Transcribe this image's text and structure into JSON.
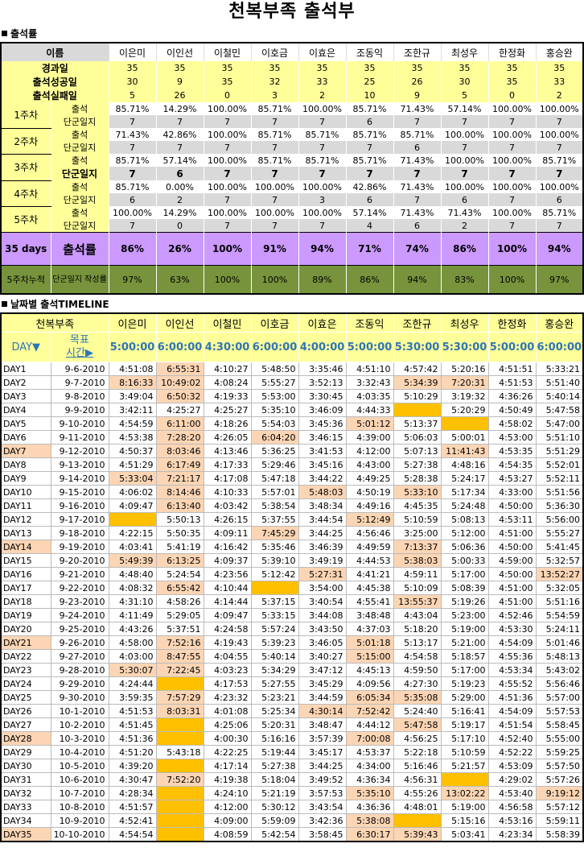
{
  "title": "천복부족 출석부",
  "section1": {
    "label": "출석률"
  },
  "section2": {
    "label": "날짜별 출석TIMELINE"
  },
  "names": [
    "이은미",
    "이인선",
    "이철민",
    "이호금",
    "이효은",
    "조동익",
    "조한규",
    "최성우",
    "한정화",
    "홍승완"
  ],
  "header_label": "이름",
  "summary": [
    {
      "label": "경과일",
      "values": [
        "35",
        "35",
        "35",
        "35",
        "35",
        "35",
        "35",
        "35",
        "35",
        "35"
      ]
    },
    {
      "label": "출석성공일",
      "values": [
        "30",
        "9",
        "35",
        "32",
        "33",
        "25",
        "26",
        "30",
        "35",
        "33"
      ]
    },
    {
      "label": "출석실패일",
      "values": [
        "5",
        "26",
        "0",
        "3",
        "2",
        "10",
        "9",
        "5",
        "0",
        "2"
      ]
    }
  ],
  "weeks": [
    {
      "label": "1주차",
      "att_label": "출석",
      "log_label": "단군일지",
      "att": [
        "85.71%",
        "14.29%",
        "100.00%",
        "85.71%",
        "100.00%",
        "85.71%",
        "71.43%",
        "57.14%",
        "100.00%",
        "100.00%"
      ],
      "log": [
        "7",
        "7",
        "7",
        "7",
        "7",
        "6",
        "7",
        "7",
        "7",
        "7"
      ]
    },
    {
      "label": "2주차",
      "att_label": "출석",
      "log_label": "단군일지",
      "att": [
        "71.43%",
        "42.86%",
        "100.00%",
        "85.71%",
        "85.71%",
        "85.71%",
        "85.71%",
        "100.00%",
        "100.00%",
        "100.00%"
      ],
      "log": [
        "7",
        "7",
        "7",
        "7",
        "7",
        "7",
        "6",
        "7",
        "7",
        "7"
      ]
    },
    {
      "label": "3주차",
      "att_label": "출석",
      "log_label": "단군일지",
      "att": [
        "85.71%",
        "57.14%",
        "100.00%",
        "85.71%",
        "85.71%",
        "85.71%",
        "71.43%",
        "100.00%",
        "100.00%",
        "85.71%"
      ],
      "log": [
        "7",
        "6",
        "7",
        "7",
        "7",
        "7",
        "7",
        "7",
        "7",
        "7"
      ]
    },
    {
      "label": "4주차",
      "att_label": "출석",
      "log_label": "단군일지",
      "att": [
        "85.71%",
        "0.00%",
        "100.00%",
        "100.00%",
        "100.00%",
        "42.86%",
        "71.43%",
        "100.00%",
        "100.00%",
        "100.00%"
      ],
      "log": [
        "6",
        "2",
        "7",
        "7",
        "3",
        "6",
        "7",
        "6",
        "7",
        "6"
      ]
    },
    {
      "label": "5주차",
      "att_label": "출석",
      "log_label": "단군일지",
      "att": [
        "100.00%",
        "14.29%",
        "100.00%",
        "100.00%",
        "100.00%",
        "57.14%",
        "71.43%",
        "71.43%",
        "100.00%",
        "85.71%"
      ],
      "log": [
        "7",
        "0",
        "7",
        "7",
        "7",
        "4",
        "6",
        "2",
        "7",
        "7"
      ]
    }
  ],
  "rate": {
    "label1": "35 days",
    "label2": "출석률",
    "values": [
      "86%",
      "26%",
      "100%",
      "91%",
      "94%",
      "71%",
      "74%",
      "86%",
      "100%",
      "94%"
    ]
  },
  "cumulative": {
    "label1": "5주차누적",
    "label2": "단군일지 작성률",
    "values": [
      "97%",
      "63%",
      "100%",
      "100%",
      "89%",
      "86%",
      "94%",
      "83%",
      "100%",
      "97%"
    ]
  },
  "timeline": {
    "corner": "천복부족",
    "day_header": "DAY▼",
    "goal_label_1": "목표",
    "goal_label_2": "시간▶",
    "goals": [
      "5:00:00",
      "6:00:00",
      "4:30:00",
      "6:00:00",
      "4:00:00",
      "5:00:00",
      "5:30:00",
      "5:30:00",
      "5:00:00",
      "6:00:00"
    ],
    "rows": [
      {
        "day": "DAY1",
        "date": "9-6-2010",
        "t": [
          "4:51:08",
          "6:55:31",
          "4:10:27",
          "5:48:50",
          "3:35:46",
          "4:51:10",
          "4:57:42",
          "5:20:16",
          "4:51:51",
          "5:33:21"
        ]
      },
      {
        "day": "DAY2",
        "date": "9-7-2010",
        "t": [
          "8:16:33",
          "10:49:02",
          "4:08:24",
          "5:55:27",
          "3:52:13",
          "3:32:43",
          "5:34:39",
          "7:20:31",
          "4:51:53",
          "5:51:40"
        ]
      },
      {
        "day": "DAY3",
        "date": "9-8-2010",
        "t": [
          "3:49:04",
          "6:50:32",
          "4:19:33",
          "5:53:00",
          "3:30:45",
          "4:03:35",
          "5:10:29",
          "3:19:32",
          "4:36:26",
          "5:40:14"
        ]
      },
      {
        "day": "DAY4",
        "date": "9-9-2010",
        "t": [
          "3:42:11",
          "4:25:27",
          "4:25:27",
          "5:35:10",
          "3:46:09",
          "4:44:33",
          "",
          "5:20:29",
          "4:50:49",
          "5:47:58"
        ]
      },
      {
        "day": "DAY5",
        "date": "9-10-2010",
        "t": [
          "4:54:59",
          "6:11:00",
          "4:18:26",
          "5:54:03",
          "3:45:36",
          "5:01:12",
          "5:13:37",
          "",
          "4:58:02",
          "5:47:00"
        ]
      },
      {
        "day": "DAY6",
        "date": "9-11-2010",
        "t": [
          "4:53:38",
          "7:28:20",
          "4:26:05",
          "6:04:20",
          "3:46:15",
          "4:39:00",
          "5:06:03",
          "5:00:01",
          "4:53:00",
          "5:51:10"
        ]
      },
      {
        "day": "DAY7",
        "date": "9-12-2010",
        "t": [
          "4:50:37",
          "8:03:46",
          "4:13:46",
          "5:36:25",
          "3:41:53",
          "4:12:00",
          "5:07:13",
          "11:41:43",
          "4:53:35",
          "5:51:29"
        ]
      },
      {
        "day": "DAY8",
        "date": "9-13-2010",
        "t": [
          "4:51:29",
          "6:17:49",
          "4:17:33",
          "5:29:46",
          "3:45:16",
          "4:43:00",
          "5:27:38",
          "4:48:16",
          "4:54:35",
          "5:52:01"
        ]
      },
      {
        "day": "DAY9",
        "date": "9-14-2010",
        "t": [
          "5:33:04",
          "7:21:17",
          "4:17:08",
          "5:47:18",
          "3:44:22",
          "4:49:25",
          "5:28:38",
          "5:24:17",
          "4:53:27",
          "5:52:11"
        ]
      },
      {
        "day": "DAY10",
        "date": "9-15-2010",
        "t": [
          "4:06:02",
          "8:14:46",
          "4:10:33",
          "5:57:01",
          "5:48:03",
          "4:50:19",
          "5:33:10",
          "5:17:34",
          "4:33:00",
          "5:51:56"
        ]
      },
      {
        "day": "DAY11",
        "date": "9-16-2010",
        "t": [
          "4:09:47",
          "6:13:40",
          "4:03:42",
          "5:38:54",
          "3:48:34",
          "4:49:16",
          "4:45:35",
          "5:24:48",
          "4:50:00",
          "5:36:30"
        ]
      },
      {
        "day": "DAY12",
        "date": "9-17-2010",
        "t": [
          "",
          "5:50:13",
          "4:26:15",
          "5:37:55",
          "3:44:54",
          "5:12:49",
          "5:10:59",
          "5:08:13",
          "4:53:11",
          "5:56:00"
        ]
      },
      {
        "day": "DAY13",
        "date": "9-18-2010",
        "t": [
          "4:22:15",
          "5:50:35",
          "4:09:11",
          "7:45:29",
          "3:44:25",
          "4:56:46",
          "3:25:00",
          "5:12:00",
          "4:51:00",
          "5:55:27"
        ]
      },
      {
        "day": "DAY14",
        "date": "9-19-2010",
        "t": [
          "4:03:41",
          "5:41:19",
          "4:16:42",
          "5:35:46",
          "3:46:39",
          "4:49:59",
          "7:13:37",
          "5:06:36",
          "4:50:00",
          "5:41:45"
        ]
      },
      {
        "day": "DAY15",
        "date": "9-20-2010",
        "t": [
          "5:49:39",
          "6:13:25",
          "4:09:37",
          "5:39:10",
          "3:49:19",
          "4:44:53",
          "5:38:03",
          "5:00:33",
          "4:59:00",
          "5:32:57"
        ]
      },
      {
        "day": "DAY16",
        "date": "9-21-2010",
        "t": [
          "4:48:40",
          "5:24:54",
          "4:23:56",
          "5:12:42",
          "5:27:31",
          "4:41:21",
          "4:59:11",
          "5:17:00",
          "4:50:00",
          "13:52:27"
        ]
      },
      {
        "day": "DAY17",
        "date": "9-22-2010",
        "t": [
          "4:08:32",
          "6:55:42",
          "4:10:44",
          "",
          "3:54:00",
          "4:45:38",
          "5:10:09",
          "5:08:39",
          "4:51:00",
          "5:32:05"
        ]
      },
      {
        "day": "DAY18",
        "date": "9-23-2010",
        "t": [
          "4:31:10",
          "4:58:26",
          "4:14:44",
          "5:37:15",
          "3:40:54",
          "4:55:41",
          "13:55:37",
          "5:19:26",
          "4:51:00",
          "5:51:16"
        ]
      },
      {
        "day": "DAY19",
        "date": "9-24-2010",
        "t": [
          "4:11:49",
          "5:29:05",
          "4:09:47",
          "5:33:15",
          "3:44:08",
          "3:48:48",
          "4:43:04",
          "5:23:00",
          "4:52:46",
          "5:54:59"
        ]
      },
      {
        "day": "DAY20",
        "date": "9-25-2010",
        "t": [
          "4:43:26",
          "5:37:51",
          "4:24:58",
          "5:57:24",
          "3:43:50",
          "4:37:03",
          "5:18:20",
          "5:19:00",
          "4:53:30",
          "5:24:11"
        ]
      },
      {
        "day": "DAY21",
        "date": "9-26-2010",
        "t": [
          "4:58:00",
          "7:52:16",
          "4:19:43",
          "5:39:23",
          "3:46:05",
          "5:01:18",
          "5:13:17",
          "5:21:00",
          "4:54:09",
          "5:01:46"
        ]
      },
      {
        "day": "DAY22",
        "date": "9-27-2010",
        "t": [
          "4:03:00",
          "8:47:55",
          "4:04:55",
          "5:40:14",
          "3:40:27",
          "5:15:00",
          "4:54:58",
          "5:18:57",
          "4:55:36",
          "5:48:13"
        ]
      },
      {
        "day": "DAY23",
        "date": "9-28-2010",
        "t": [
          "5:30:07",
          "7:22:45",
          "4:03:23",
          "5:34:29",
          "3:47:12",
          "4:45:13",
          "4:59:50",
          "5:17:00",
          "4:53:34",
          "5:43:02"
        ]
      },
      {
        "day": "DAY24",
        "date": "9-29-2010",
        "t": [
          "4:24:44",
          "",
          "4:17:53",
          "5:27:55",
          "3:45:29",
          "4:09:56",
          "4:27:30",
          "5:19:23",
          "4:55:52",
          "5:56:46"
        ]
      },
      {
        "day": "DAY25",
        "date": "9-30-2010",
        "t": [
          "3:59:35",
          "7:57:29",
          "4:23:32",
          "5:23:21",
          "3:44:59",
          "6:05:34",
          "5:35:08",
          "5:29:00",
          "4:51:36",
          "5:57:00"
        ]
      },
      {
        "day": "DAY26",
        "date": "10-1-2010",
        "t": [
          "4:51:53",
          "8:03:31",
          "4:01:08",
          "5:25:34",
          "4:30:14",
          "7:52:42",
          "5:24:40",
          "5:16:41",
          "4:54:09",
          "5:57:53"
        ]
      },
      {
        "day": "DAY27",
        "date": "10-2-2010",
        "t": [
          "4:51:45",
          "",
          "4:25:06",
          "5:20:31",
          "3:48:47",
          "4:44:12",
          "5:47:58",
          "5:19:17",
          "4:51:54",
          "5:58:45"
        ]
      },
      {
        "day": "DAY28",
        "date": "10-3-2010",
        "t": [
          "4:51:36",
          "",
          "4:00:30",
          "5:16:16",
          "3:57:39",
          "7:00:08",
          "4:56:25",
          "5:17:10",
          "4:52:40",
          "5:55:00"
        ]
      },
      {
        "day": "DAY29",
        "date": "10-4-2010",
        "t": [
          "4:51:20",
          "5:43:18",
          "4:22:25",
          "5:19:44",
          "3:45:17",
          "4:53:37",
          "5:22:18",
          "5:10:59",
          "4:52:22",
          "5:59:25"
        ]
      },
      {
        "day": "DAY30",
        "date": "10-5-2010",
        "t": [
          "4:39:20",
          "",
          "4:17:14",
          "5:27:38",
          "3:44:25",
          "4:34:00",
          "5:16:46",
          "5:21:57",
          "4:53:09",
          "5:57:50"
        ]
      },
      {
        "day": "DAY31",
        "date": "10-6-2010",
        "t": [
          "4:30:47",
          "7:52:20",
          "4:19:38",
          "5:18:04",
          "3:49:52",
          "4:36:34",
          "4:56:31",
          "",
          "4:29:02",
          "5:57:26"
        ]
      },
      {
        "day": "DAY32",
        "date": "10-7-2010",
        "t": [
          "4:28:34",
          "",
          "4:24:10",
          "5:21:19",
          "3:57:53",
          "5:35:10",
          "4:55:26",
          "13:02:22",
          "4:53:40",
          "9:19:12"
        ]
      },
      {
        "day": "DAY33",
        "date": "10-8-2010",
        "t": [
          "4:51:57",
          "",
          "4:12:00",
          "5:30:12",
          "3:43:54",
          "4:36:36",
          "4:48:01",
          "5:19:00",
          "4:56:58",
          "5:57:12"
        ]
      },
      {
        "day": "DAY34",
        "date": "10-9-2010",
        "t": [
          "4:52:41",
          "",
          "4:09:00",
          "5:59:09",
          "3:42:36",
          "5:38:08",
          "",
          "5:15:16",
          "4:53:16",
          "5:59:11"
        ]
      },
      {
        "day": "DAY35",
        "date": "10-10-2010",
        "t": [
          "4:54:54",
          "",
          "4:08:59",
          "5:42:54",
          "3:58:45",
          "6:30:17",
          "5:39:43",
          "5:03:41",
          "4:23:34",
          "5:58:39"
        ]
      }
    ]
  },
  "colors": {
    "summary_bg": "#ffff99",
    "rate_bg": "#cc99ff",
    "cum_bg": "#77933c",
    "late_bg": "#fcd5b4",
    "miss_bg": "#ffc000",
    "goal_text": "#2e75b6"
  }
}
